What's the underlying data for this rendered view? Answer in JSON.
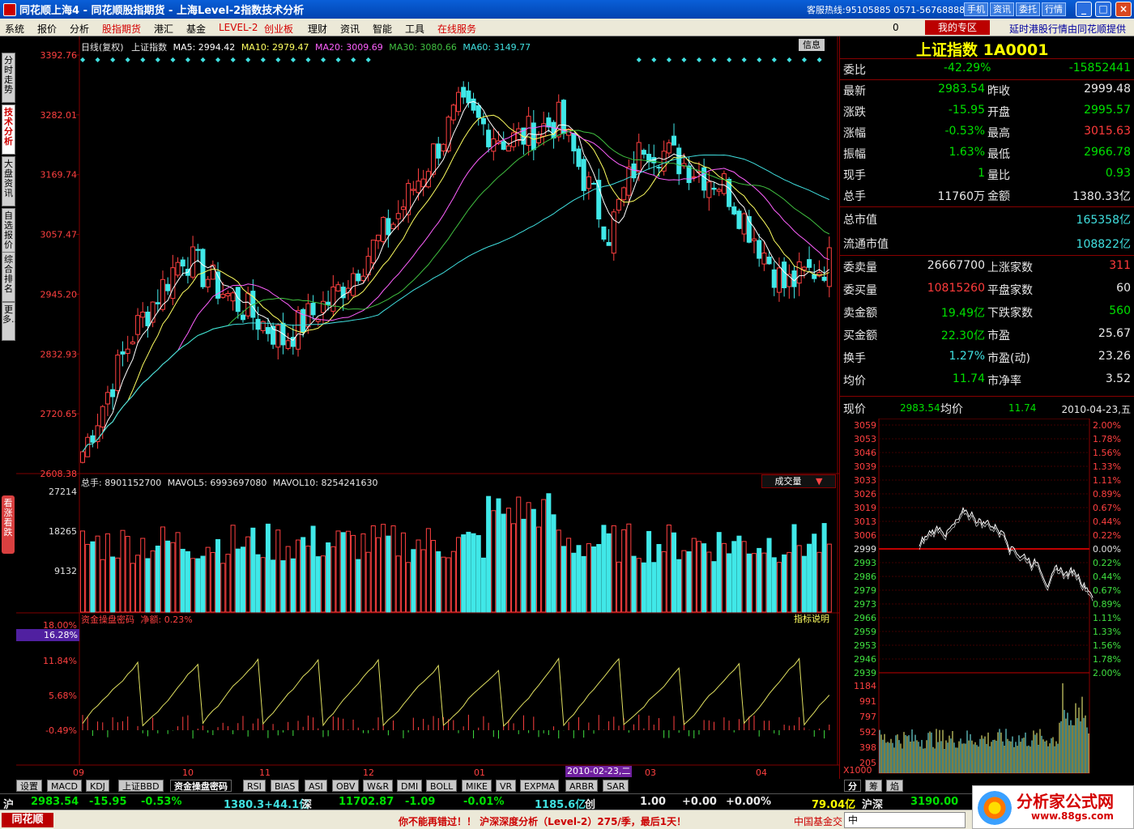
{
  "window": {
    "title": "同花顺上海4 - 同花顺股指期货 - 上海Level-2指数技术分析",
    "hotline": "客服热线:95105885 0571-56768888",
    "buttons": [
      "手机",
      "资讯",
      "委托",
      "行情"
    ],
    "minimize": "_",
    "maximize": "□",
    "close": "×"
  },
  "menu": {
    "items": [
      "系统",
      "报价",
      "分析",
      "股指期货",
      "港汇",
      "基金",
      "LEVEL-2",
      "创业板",
      "理财",
      "资讯",
      "智能",
      "工具",
      "在线服务"
    ],
    "red_items": [
      "股指期货",
      "LEVEL-2",
      "创业板",
      "在线服务"
    ],
    "message_count": "0",
    "zone": "我的专区",
    "provider": "延时港股行情由同花顺提供"
  },
  "left_tabs": [
    "分时走势",
    "技术分析",
    "大盘资讯",
    "自选报价",
    "综合排名",
    "更多..."
  ],
  "kanzhang": "看涨看跌",
  "main_chart": {
    "header": {
      "period": "日线(复权)",
      "name": "上证指数",
      "ma5": "MA5: 2994.42",
      "ma10": "MA10: 2979.47",
      "ma20": "MA20: 3009.69",
      "ma30": "MA30: 3080.66",
      "ma60": "MA60: 3149.77"
    },
    "info_button": "信息",
    "y_labels": [
      "3392.76",
      "3282.01",
      "3169.74",
      "3057.47",
      "2945.20",
      "2832.93",
      "2720.65",
      "2608.38"
    ],
    "colors": {
      "up": "#ff4040",
      "down": "#40e8e8",
      "ma5": "#ffffff",
      "ma10": "#ffff60",
      "ma20": "#ff60ff",
      "ma30": "#40c040",
      "ma60": "#40e0e0",
      "grid": "#800000"
    }
  },
  "volume_panel": {
    "label": "总手: 8901152700",
    "mavol5": "MAVOL5: 6993697080",
    "mavol10": "MAVOL10: 8254241630",
    "selector": "成交量",
    "y_labels": [
      "27214",
      "18265",
      "9132"
    ]
  },
  "fund_panel": {
    "label": "资金操盘密码",
    "net_label": "净额: 0.23%",
    "explain": "指标说明",
    "y_labels": [
      "18.00%",
      "11.84%",
      "5.68%",
      "-0.49%"
    ],
    "marker": "16.28%"
  },
  "x_labels": [
    "09",
    "10",
    "11",
    "12",
    "01",
    "2010-02-23,二",
    "03",
    "04"
  ],
  "quote": {
    "title": "上证指数 1A0001",
    "weibi": {
      "label": "委比",
      "pct": "-42.29%",
      "val": "-15852441"
    },
    "rows": [
      {
        "l1": "最新",
        "v1": "2983.54",
        "c1": "g",
        "l2": "昨收",
        "v2": "2999.48",
        "c2": "w"
      },
      {
        "l1": "涨跌",
        "v1": "-15.95",
        "c1": "g",
        "l2": "开盘",
        "v2": "2995.57",
        "c2": "g"
      },
      {
        "l1": "涨幅",
        "v1": "-0.53%",
        "c1": "g",
        "l2": "最高",
        "v2": "3015.63",
        "c2": "r"
      },
      {
        "l1": "振幅",
        "v1": "1.63%",
        "c1": "g",
        "l2": "最低",
        "v2": "2966.78",
        "c2": "g"
      },
      {
        "l1": "现手",
        "v1": "1",
        "c1": "g",
        "l2": "量比",
        "v2": "0.93",
        "c2": "g"
      },
      {
        "l1": "总手",
        "v1": "11760万",
        "c1": "w",
        "l2": "金额",
        "v2": "1380.33亿",
        "c2": "w"
      }
    ],
    "market": [
      {
        "l": "总市值",
        "v": "165358亿"
      },
      {
        "l": "流通市值",
        "v": "108822亿"
      }
    ],
    "orders": [
      {
        "l1": "委卖量",
        "v1": "26667700",
        "c1": "w",
        "l2": "上涨家数",
        "v2": "311",
        "c2": "r"
      },
      {
        "l1": "委买量",
        "v1": "10815260",
        "c1": "r",
        "l2": "平盘家数",
        "v2": "60",
        "c2": "w"
      },
      {
        "l1": "卖金额",
        "v1": "19.49亿",
        "c1": "g",
        "l2": "下跌家数",
        "v2": "560",
        "c2": "g"
      },
      {
        "l1": "买金额",
        "v1": "22.30亿",
        "c1": "g",
        "l2": "市盈",
        "v2": "25.67",
        "c2": "w"
      },
      {
        "l1": "换手",
        "v1": "1.27%",
        "c1": "c",
        "l2": "市盈(动)",
        "v2": "23.26",
        "c2": "w"
      },
      {
        "l1": "均价",
        "v1": "11.74",
        "c1": "g",
        "l2": "市净率",
        "v2": "3.52",
        "c2": "w"
      }
    ]
  },
  "mini": {
    "price_label": "现价",
    "price": "2983.54",
    "avg_label": "均价",
    "avg": "11.74",
    "date": "2010-04-23,五",
    "prices": [
      "3059",
      "3053",
      "3046",
      "3039",
      "3033",
      "3026",
      "3019",
      "3013",
      "3006",
      "2999",
      "2993",
      "2986",
      "2979",
      "2973",
      "2966",
      "2959",
      "2953",
      "2946",
      "2939"
    ],
    "pcts": [
      "2.00%",
      "1.78%",
      "1.56%",
      "1.33%",
      "1.11%",
      "0.89%",
      "0.67%",
      "0.44%",
      "0.22%",
      "0.00%",
      "0.22%",
      "0.44%",
      "0.67%",
      "0.89%",
      "1.11%",
      "1.33%",
      "1.56%",
      "1.78%",
      "2.00%"
    ],
    "vol_labels": [
      "1184",
      "991",
      "797",
      "592",
      "398",
      "205"
    ],
    "unit": "X1000"
  },
  "bottom_tabs": [
    "设置",
    "MACD",
    "KDJ",
    "上证BBD",
    "资金操盘密码",
    "RSI",
    "BIAS",
    "ASI",
    "OBV",
    "W&R",
    "DMI",
    "BOLL",
    "MIKE",
    "VR",
    "EXPMA",
    "ARBR",
    "SAR"
  ],
  "right_tabs": [
    "分",
    "筹",
    "焰"
  ],
  "ticker": {
    "sh_label": "沪",
    "sh_price": "2983.54",
    "sh_chg": "-15.95",
    "sh_pct": "-0.53%",
    "sh_amt": "1380.3+44.1亿",
    "sz_label": "深",
    "sz_price": "11702.87",
    "sz_chg": "-1.09",
    "sz_pct": "-0.01%",
    "sz_amt": "1185.6亿",
    "cy_label": "创",
    "cy_a": "1.00",
    "cy_b": "+0.00",
    "cy_c": "+0.00%",
    "cy_d": "79.04亿",
    "hs_label": "沪深",
    "hs_val": "3190.00"
  },
  "status": {
    "logo": "同花顺",
    "scroll": "你不能再错过！！ 沪深深度分析（Level-2）275/季，最后1天！",
    "news": "中国基金交",
    "ime": "中"
  },
  "watermark": {
    "brand": "分析家公式网",
    "url": "www.88gs.com"
  }
}
